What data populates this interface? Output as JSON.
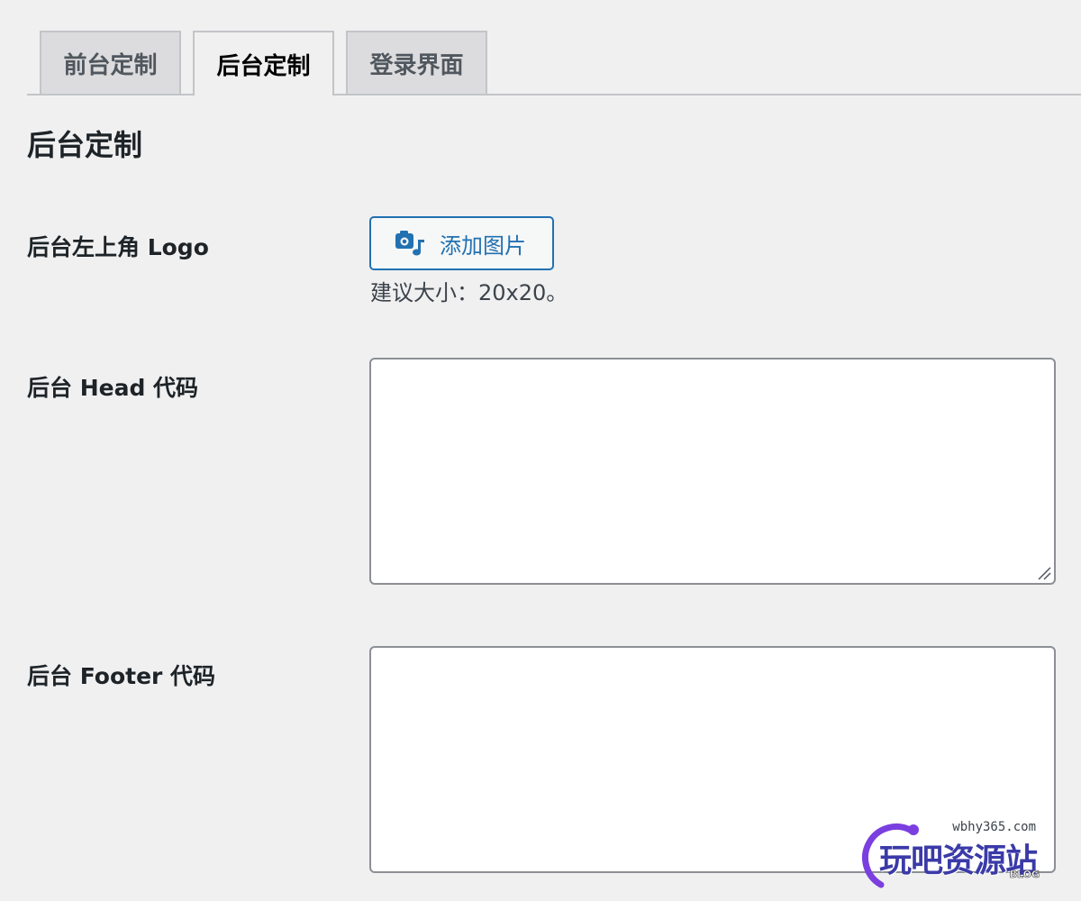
{
  "tabs": [
    {
      "label": "前台定制",
      "active": false
    },
    {
      "label": "后台定制",
      "active": true
    },
    {
      "label": "登录界面",
      "active": false
    }
  ],
  "section": {
    "title": "后台定制"
  },
  "fields": {
    "logo": {
      "label": "后台左上角 Logo",
      "button_label": "添加图片",
      "button_icon": "add-media-icon",
      "hint": "建议大小：20x20。"
    },
    "head_code": {
      "label": "后台 Head 代码",
      "value": ""
    },
    "footer_code": {
      "label": "后台 Footer 代码",
      "value": ""
    }
  },
  "watermark": {
    "url": "wbhy365.com",
    "text": "玩吧资源站",
    "sub": "BLOG"
  },
  "colors": {
    "accent": "#2271b1",
    "background": "#f0f0f1",
    "border": "#8c8f94",
    "watermark": "#3b3aa8"
  }
}
